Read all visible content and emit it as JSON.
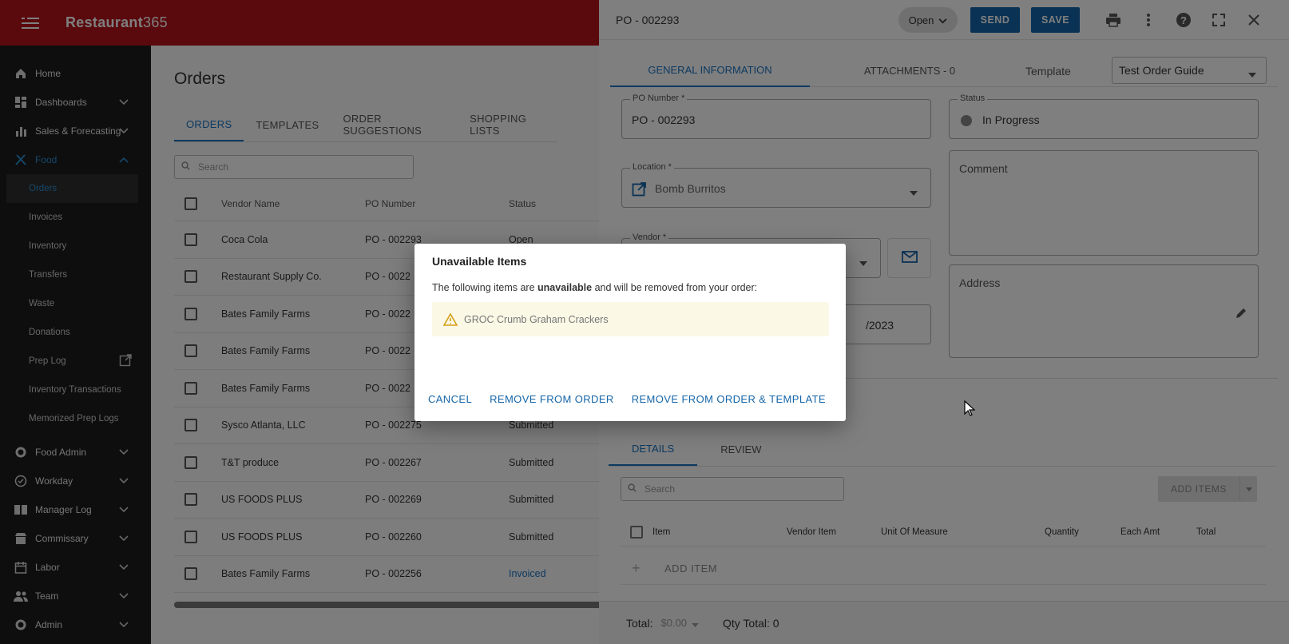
{
  "app": {
    "brand": "Restaurant",
    "brand_num": "365"
  },
  "sidebar": {
    "items": [
      {
        "label": "Home"
      },
      {
        "label": "Dashboards"
      },
      {
        "label": "Sales & Forecasting"
      },
      {
        "label": "Food"
      }
    ],
    "food_sub": [
      {
        "label": "Orders"
      },
      {
        "label": "Invoices"
      },
      {
        "label": "Inventory"
      },
      {
        "label": "Transfers"
      },
      {
        "label": "Waste"
      },
      {
        "label": "Donations"
      },
      {
        "label": "Prep Log"
      },
      {
        "label": "Inventory Transactions"
      },
      {
        "label": "Memorized Prep Logs"
      }
    ],
    "bottom_items": [
      {
        "label": "Food Admin"
      },
      {
        "label": "Workday"
      },
      {
        "label": "Manager Log"
      },
      {
        "label": "Commissary"
      },
      {
        "label": "Labor"
      },
      {
        "label": "Team"
      },
      {
        "label": "Admin"
      }
    ]
  },
  "main": {
    "title": "Orders",
    "tabs": [
      "ORDERS",
      "TEMPLATES",
      "ORDER SUGGESTIONS",
      "SHOPPING LISTS"
    ],
    "search_placeholder": "Search",
    "columns": [
      "Vendor Name",
      "PO Number",
      "Status"
    ],
    "rows": [
      {
        "vendor": "Coca Cola",
        "po": "PO - 002293",
        "status": "Open"
      },
      {
        "vendor": "Restaurant Supply Co.",
        "po": "PO - 0022",
        "status": ""
      },
      {
        "vendor": "Bates Family Farms",
        "po": "PO - 0022",
        "status": ""
      },
      {
        "vendor": "Bates Family Farms",
        "po": "PO - 0022",
        "status": ""
      },
      {
        "vendor": "Bates Family Farms",
        "po": "PO - 0022",
        "status": ""
      },
      {
        "vendor": "Sysco Atlanta, LLC",
        "po": "PO - 002275",
        "status": "Submitted"
      },
      {
        "vendor": "T&T produce",
        "po": "PO - 002267",
        "status": "Submitted"
      },
      {
        "vendor": "US FOODS PLUS",
        "po": "PO - 002269",
        "status": "Submitted"
      },
      {
        "vendor": "US FOODS PLUS",
        "po": "PO - 002260",
        "status": "Submitted"
      },
      {
        "vendor": "Bates Family Farms",
        "po": "PO - 002256",
        "status": "Invoiced"
      }
    ]
  },
  "panel": {
    "title": "PO - 002293",
    "status_pill": "Open",
    "send_label": "SEND",
    "save_label": "SAVE",
    "tabs": [
      "GENERAL INFORMATION",
      "ATTACHMENTS - 0"
    ],
    "template_label": "Template",
    "template_value": "Test Order Guide",
    "po_number_label": "PO Number *",
    "po_number_value": "PO - 002293",
    "status_label": "Status",
    "status_value": "In Progress",
    "location_label": "Location *",
    "location_value": "Bomb Burritos",
    "comment_placeholder": "Comment",
    "vendor_label": "Vendor *",
    "address_placeholder": "Address",
    "date_partial": "/2023",
    "detail_tabs": [
      "DETAILS",
      "REVIEW"
    ],
    "detail_search_placeholder": "Search",
    "add_items_label": "ADD ITEMS",
    "detail_columns": [
      "Item",
      "Vendor Item",
      "Unit Of Measure",
      "Quantity",
      "Each Amt",
      "Total"
    ],
    "add_item_label": "ADD ITEM",
    "total_label": "Total:",
    "total_value": "$0.00",
    "qty_total": "Qty Total: 0"
  },
  "dialog": {
    "title": "Unavailable Items",
    "msg_pre": "The following items are ",
    "msg_bold": "unavailable",
    "msg_post": " and will be removed from your order:",
    "item": "GROC Crumb Graham Crackers",
    "cancel": "CANCEL",
    "remove_order": "REMOVE FROM ORDER",
    "remove_order_template": "REMOVE FROM ORDER & TEMPLATE"
  },
  "colors": {
    "brand_red": "#b5121b",
    "primary_blue": "#1565a8",
    "sidebar_bg": "#1c1c1c"
  }
}
